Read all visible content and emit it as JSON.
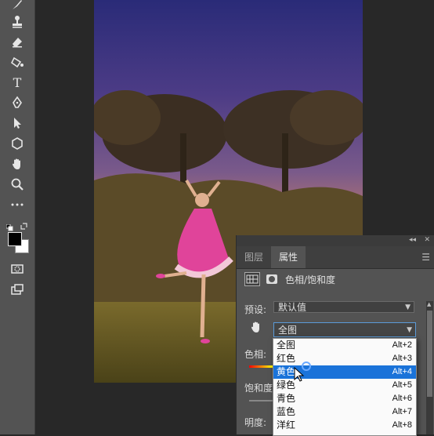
{
  "toolbar": {
    "tools": [
      {
        "name": "brush-icon"
      },
      {
        "name": "stamp-icon"
      },
      {
        "name": "eraser-icon"
      },
      {
        "name": "paint-bucket-icon"
      },
      {
        "name": "type-tool",
        "label": "T"
      },
      {
        "name": "pen-icon"
      },
      {
        "name": "path-select-icon"
      },
      {
        "name": "shape-icon"
      },
      {
        "name": "hand-icon"
      },
      {
        "name": "zoom-icon"
      },
      {
        "name": "more-tools-icon"
      }
    ],
    "foreground_color": "#000000",
    "background_color": "#ffffff"
  },
  "panel": {
    "tabs": [
      {
        "label": "图层",
        "active": false
      },
      {
        "label": "属性",
        "active": true
      }
    ],
    "adjustment_title": "色相/饱和度",
    "preset_label": "预设:",
    "preset_value": "默认值",
    "channel_value": "全图",
    "hue_label": "色相:",
    "saturation_label": "饱和度",
    "lightness_label": "明度:"
  },
  "dropdown": {
    "options": [
      {
        "label": "全图",
        "shortcut": "Alt+2"
      },
      {
        "label": "红色",
        "shortcut": "Alt+3"
      },
      {
        "label": "黄色",
        "shortcut": "Alt+4"
      },
      {
        "label": "绿色",
        "shortcut": "Alt+5"
      },
      {
        "label": "青色",
        "shortcut": "Alt+6"
      },
      {
        "label": "蓝色",
        "shortcut": "Alt+7"
      },
      {
        "label": "洋红",
        "shortcut": "Alt+8"
      }
    ],
    "selected_index": 2
  },
  "colors": {
    "selection": "#1a73d9",
    "panel_bg": "#535353"
  }
}
